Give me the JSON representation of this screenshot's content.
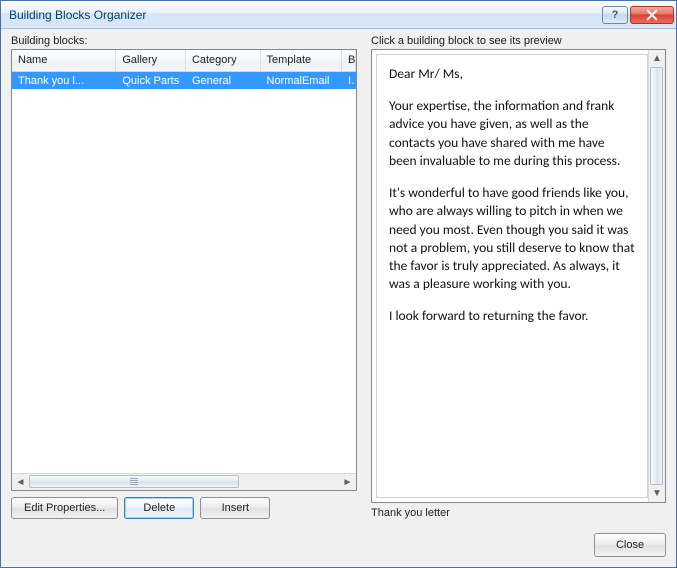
{
  "window": {
    "title": "Building Blocks Organizer"
  },
  "leftPane": {
    "label": "Building blocks:",
    "columns": [
      "Name",
      "Gallery",
      "Category",
      "Template",
      "B"
    ],
    "rows": [
      {
        "name": "Thank you l...",
        "gallery": "Quick Parts",
        "category": "General",
        "template": "NormalEmail",
        "b": "In"
      }
    ],
    "actions": {
      "edit": "Edit Properties...",
      "delete": "Delete",
      "insert": "Insert"
    }
  },
  "rightPane": {
    "label": "Click a building block to see its preview",
    "preview": {
      "p1": "Dear Mr/ Ms,",
      "p2": "Your expertise, the information and frank advice you have given, as well as the contacts you have shared with me have been invaluable to me during this process.",
      "p3": "It's wonderful to have good friends like you, who are always willing to pitch in when we need you most. Even though you said it was not a problem, you still deserve to know that the favor is truly appreciated. As always, it was a pleasure working with you.",
      "p4": "I look forward to returning the favor."
    },
    "caption": "Thank you letter"
  },
  "footer": {
    "close": "Close"
  }
}
